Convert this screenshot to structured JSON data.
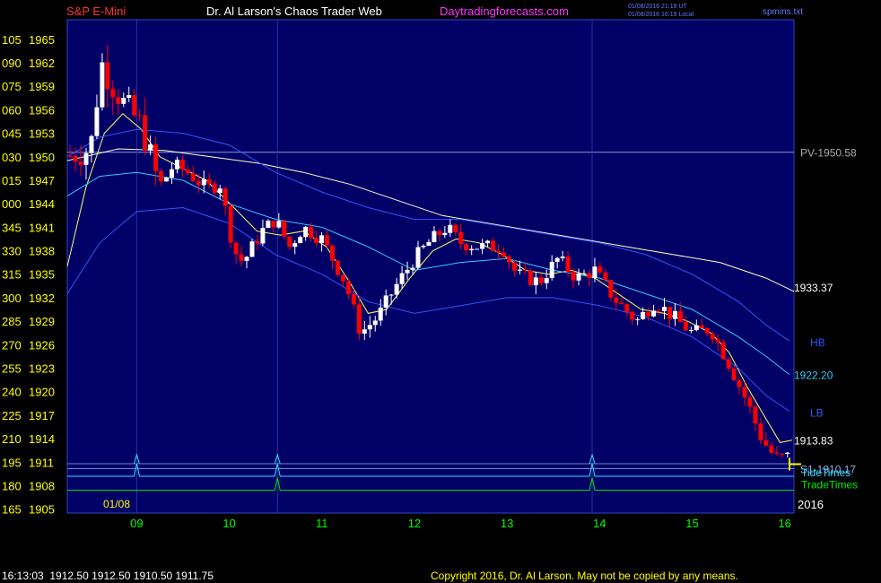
{
  "header": {
    "symbol": "S&P E-Mini",
    "site_title": "Dr. Al Larson's Chaos Trader Web",
    "site_link": "Daytradingforecasts.com",
    "timestamp_utc": "01/08/2016 21:19 UT",
    "timestamp_local": "01/08/2016 16:19 Local",
    "file_name": "spmins.txt"
  },
  "footer": {
    "quote": "16:13:03  1912.50 1912.50 1910.50 1911.75",
    "copyright": "Copyright 2016, Dr. Al Larson. May not be copied by any means."
  },
  "colors": {
    "background": "#000000",
    "plot_background": "#000066",
    "up_candle": "#ffffff",
    "down_candle": "#ff0000",
    "header_red": "#ff3333",
    "header_white": "#ffffff",
    "header_magenta": "#ff33ff",
    "axis_yellow": "#ffff00",
    "day_green": "#00ff00",
    "envelope_blue": "#3355ff",
    "envelope_cyan": "#33ccff",
    "long_ma": "#ffffcc",
    "short_ma": "#ffff66",
    "tide": "#33ddff",
    "trade": "#00ee00"
  },
  "chart_data": {
    "type": "candlestick",
    "xlabel": "",
    "ylabel": "",
    "ylim": [
      1904.5,
      1967.5
    ],
    "y_ticks": [
      {
        "code": "105",
        "price": "1965"
      },
      {
        "code": "090",
        "price": "1962"
      },
      {
        "code": "075",
        "price": "1959"
      },
      {
        "code": "060",
        "price": "1956"
      },
      {
        "code": "045",
        "price": "1953"
      },
      {
        "code": "030",
        "price": "1950"
      },
      {
        "code": "015",
        "price": "1947"
      },
      {
        "code": "000",
        "price": "1944"
      },
      {
        "code": "345",
        "price": "1941"
      },
      {
        "code": "330",
        "price": "1938"
      },
      {
        "code": "315",
        "price": "1935"
      },
      {
        "code": "300",
        "price": "1932"
      },
      {
        "code": "285",
        "price": "1929"
      },
      {
        "code": "270",
        "price": "1926"
      },
      {
        "code": "255",
        "price": "1923"
      },
      {
        "code": "240",
        "price": "1920"
      },
      {
        "code": "225",
        "price": "1917"
      },
      {
        "code": "210",
        "price": "1914"
      },
      {
        "code": "195",
        "price": "1911"
      },
      {
        "code": "180",
        "price": "1908"
      },
      {
        "code": "165",
        "price": "1905"
      }
    ],
    "x_ticks": [
      "09",
      "10",
      "11",
      "12",
      "13",
      "14",
      "15",
      "16"
    ],
    "x_range": [
      8.25,
      16.1
    ],
    "start_date_label": "01/08",
    "year_label": "2016",
    "reference_lines": [
      {
        "label": "PV-1950.58",
        "value": 1950.58
      },
      {
        "label": "S1-1910.17",
        "value": 1910.17
      }
    ],
    "curve_labels": [
      {
        "label": "1933.37",
        "value": 1933.37,
        "series": "long_ma"
      },
      {
        "label": "HB",
        "value": 1926.4,
        "series": "upper_band"
      },
      {
        "label": "1922.20",
        "value": 1922.2,
        "series": "mid_band"
      },
      {
        "label": "LB",
        "value": 1917.4,
        "series": "lower_band"
      },
      {
        "label": "1913.83",
        "value": 1913.83,
        "series": "short_ma"
      }
    ],
    "timing_lines": {
      "tide": {
        "label": "TideTimes",
        "base": 1909.2,
        "spikes": [
          9.0,
          10.52,
          13.92
        ]
      },
      "trade": {
        "label": "TradeTimes",
        "base": 1907.4,
        "spikes": [
          10.52,
          13.92
        ]
      },
      "marker": {
        "base": 1910.8
      }
    },
    "vertical_markers": [
      9.0,
      10.52,
      13.92
    ],
    "price_path": [
      [
        8.25,
        1950.0
      ],
      [
        8.5,
        1951.0
      ],
      [
        8.62,
        1962.0
      ],
      [
        8.72,
        1959.5
      ],
      [
        8.85,
        1957.0
      ],
      [
        9.05,
        1954.0
      ],
      [
        9.25,
        1946.0
      ],
      [
        9.4,
        1949.0
      ],
      [
        9.55,
        1948.0
      ],
      [
        9.75,
        1946.0
      ],
      [
        9.9,
        1946.5
      ],
      [
        10.05,
        1938.0
      ],
      [
        10.15,
        1936.5
      ],
      [
        10.35,
        1940.5
      ],
      [
        10.5,
        1942.0
      ],
      [
        10.65,
        1938.5
      ],
      [
        10.8,
        1941.0
      ],
      [
        11.0,
        1939.5
      ],
      [
        11.25,
        1934.0
      ],
      [
        11.42,
        1927.5
      ],
      [
        11.6,
        1929.5
      ],
      [
        11.8,
        1933.5
      ],
      [
        12.0,
        1937.0
      ],
      [
        12.15,
        1939.0
      ],
      [
        12.35,
        1941.0
      ],
      [
        12.5,
        1939.0
      ],
      [
        12.7,
        1938.5
      ],
      [
        12.95,
        1938.5
      ],
      [
        13.1,
        1935.0
      ],
      [
        13.35,
        1934.0
      ],
      [
        13.55,
        1937.0
      ],
      [
        13.75,
        1934.5
      ],
      [
        13.95,
        1935.5
      ],
      [
        14.15,
        1932.0
      ],
      [
        14.4,
        1929.0
      ],
      [
        14.6,
        1931.5
      ],
      [
        14.8,
        1929.5
      ],
      [
        15.0,
        1927.5
      ],
      [
        15.2,
        1928.0
      ],
      [
        15.4,
        1923.5
      ],
      [
        15.6,
        1918.5
      ],
      [
        15.75,
        1914.0
      ],
      [
        15.9,
        1911.5
      ],
      [
        16.05,
        1911.75
      ]
    ],
    "series": [
      {
        "key": "short_ma",
        "points": [
          [
            8.25,
            1936.0
          ],
          [
            8.45,
            1946.0
          ],
          [
            8.65,
            1953.0
          ],
          [
            8.85,
            1955.5
          ],
          [
            9.05,
            1953.5
          ],
          [
            9.25,
            1950.0
          ],
          [
            9.5,
            1948.5
          ],
          [
            9.75,
            1947.0
          ],
          [
            10.05,
            1943.5
          ],
          [
            10.3,
            1940.5
          ],
          [
            10.55,
            1940.0
          ],
          [
            10.8,
            1940.5
          ],
          [
            11.05,
            1938.5
          ],
          [
            11.3,
            1934.0
          ],
          [
            11.5,
            1930.0
          ],
          [
            11.7,
            1930.5
          ],
          [
            11.95,
            1934.5
          ],
          [
            12.2,
            1938.0
          ],
          [
            12.45,
            1939.5
          ],
          [
            12.7,
            1939.0
          ],
          [
            12.95,
            1937.5
          ],
          [
            13.2,
            1935.5
          ],
          [
            13.45,
            1935.0
          ],
          [
            13.7,
            1935.5
          ],
          [
            13.95,
            1934.5
          ],
          [
            14.2,
            1932.5
          ],
          [
            14.45,
            1930.5
          ],
          [
            14.7,
            1930.0
          ],
          [
            14.95,
            1929.0
          ],
          [
            15.2,
            1927.5
          ],
          [
            15.4,
            1925.0
          ],
          [
            15.6,
            1920.5
          ],
          [
            15.8,
            1916.5
          ],
          [
            15.95,
            1913.5
          ],
          [
            16.08,
            1913.8
          ]
        ]
      },
      {
        "key": "long_ma",
        "points": [
          [
            8.25,
            1949.5
          ],
          [
            8.8,
            1951.0
          ],
          [
            9.3,
            1950.8
          ],
          [
            9.8,
            1950.0
          ],
          [
            10.3,
            1949.2
          ],
          [
            10.8,
            1948.0
          ],
          [
            11.3,
            1946.5
          ],
          [
            11.8,
            1944.5
          ],
          [
            12.3,
            1942.5
          ],
          [
            12.8,
            1941.5
          ],
          [
            13.3,
            1940.5
          ],
          [
            13.8,
            1939.5
          ],
          [
            14.3,
            1938.5
          ],
          [
            14.8,
            1937.5
          ],
          [
            15.3,
            1936.5
          ],
          [
            15.8,
            1934.5
          ],
          [
            16.1,
            1932.8
          ]
        ]
      },
      {
        "key": "upper_band",
        "points": [
          [
            8.25,
            1950.0
          ],
          [
            8.6,
            1952.5
          ],
          [
            9.0,
            1953.5
          ],
          [
            9.5,
            1953.0
          ],
          [
            10.0,
            1951.5
          ],
          [
            10.5,
            1948.0
          ],
          [
            11.0,
            1945.5
          ],
          [
            11.5,
            1943.5
          ],
          [
            12.0,
            1942.0
          ],
          [
            12.5,
            1942.0
          ],
          [
            13.0,
            1941.0
          ],
          [
            13.5,
            1940.0
          ],
          [
            14.0,
            1939.0
          ],
          [
            14.5,
            1937.5
          ],
          [
            15.0,
            1935.0
          ],
          [
            15.5,
            1931.5
          ],
          [
            15.8,
            1928.5
          ],
          [
            16.05,
            1926.5
          ]
        ]
      },
      {
        "key": "mid_band",
        "points": [
          [
            8.25,
            1945.0
          ],
          [
            8.6,
            1947.5
          ],
          [
            9.0,
            1948.0
          ],
          [
            9.5,
            1947.0
          ],
          [
            10.0,
            1944.0
          ],
          [
            10.5,
            1942.0
          ],
          [
            11.0,
            1941.0
          ],
          [
            11.5,
            1938.5
          ],
          [
            12.0,
            1935.5
          ],
          [
            12.5,
            1936.5
          ],
          [
            13.0,
            1937.0
          ],
          [
            13.5,
            1935.5
          ],
          [
            14.0,
            1934.5
          ],
          [
            14.5,
            1932.5
          ],
          [
            15.0,
            1930.5
          ],
          [
            15.5,
            1927.0
          ],
          [
            15.8,
            1924.5
          ],
          [
            16.05,
            1922.2
          ]
        ]
      },
      {
        "key": "lower_band",
        "points": [
          [
            8.25,
            1932.5
          ],
          [
            8.6,
            1939.0
          ],
          [
            9.0,
            1943.0
          ],
          [
            9.5,
            1943.5
          ],
          [
            10.0,
            1941.5
          ],
          [
            10.5,
            1937.5
          ],
          [
            11.0,
            1935.0
          ],
          [
            11.5,
            1931.5
          ],
          [
            12.0,
            1930.0
          ],
          [
            12.5,
            1931.0
          ],
          [
            13.0,
            1932.0
          ],
          [
            13.5,
            1932.0
          ],
          [
            14.0,
            1931.0
          ],
          [
            14.5,
            1929.5
          ],
          [
            15.0,
            1927.0
          ],
          [
            15.5,
            1923.0
          ],
          [
            15.8,
            1919.5
          ],
          [
            16.05,
            1917.5
          ]
        ]
      }
    ]
  }
}
